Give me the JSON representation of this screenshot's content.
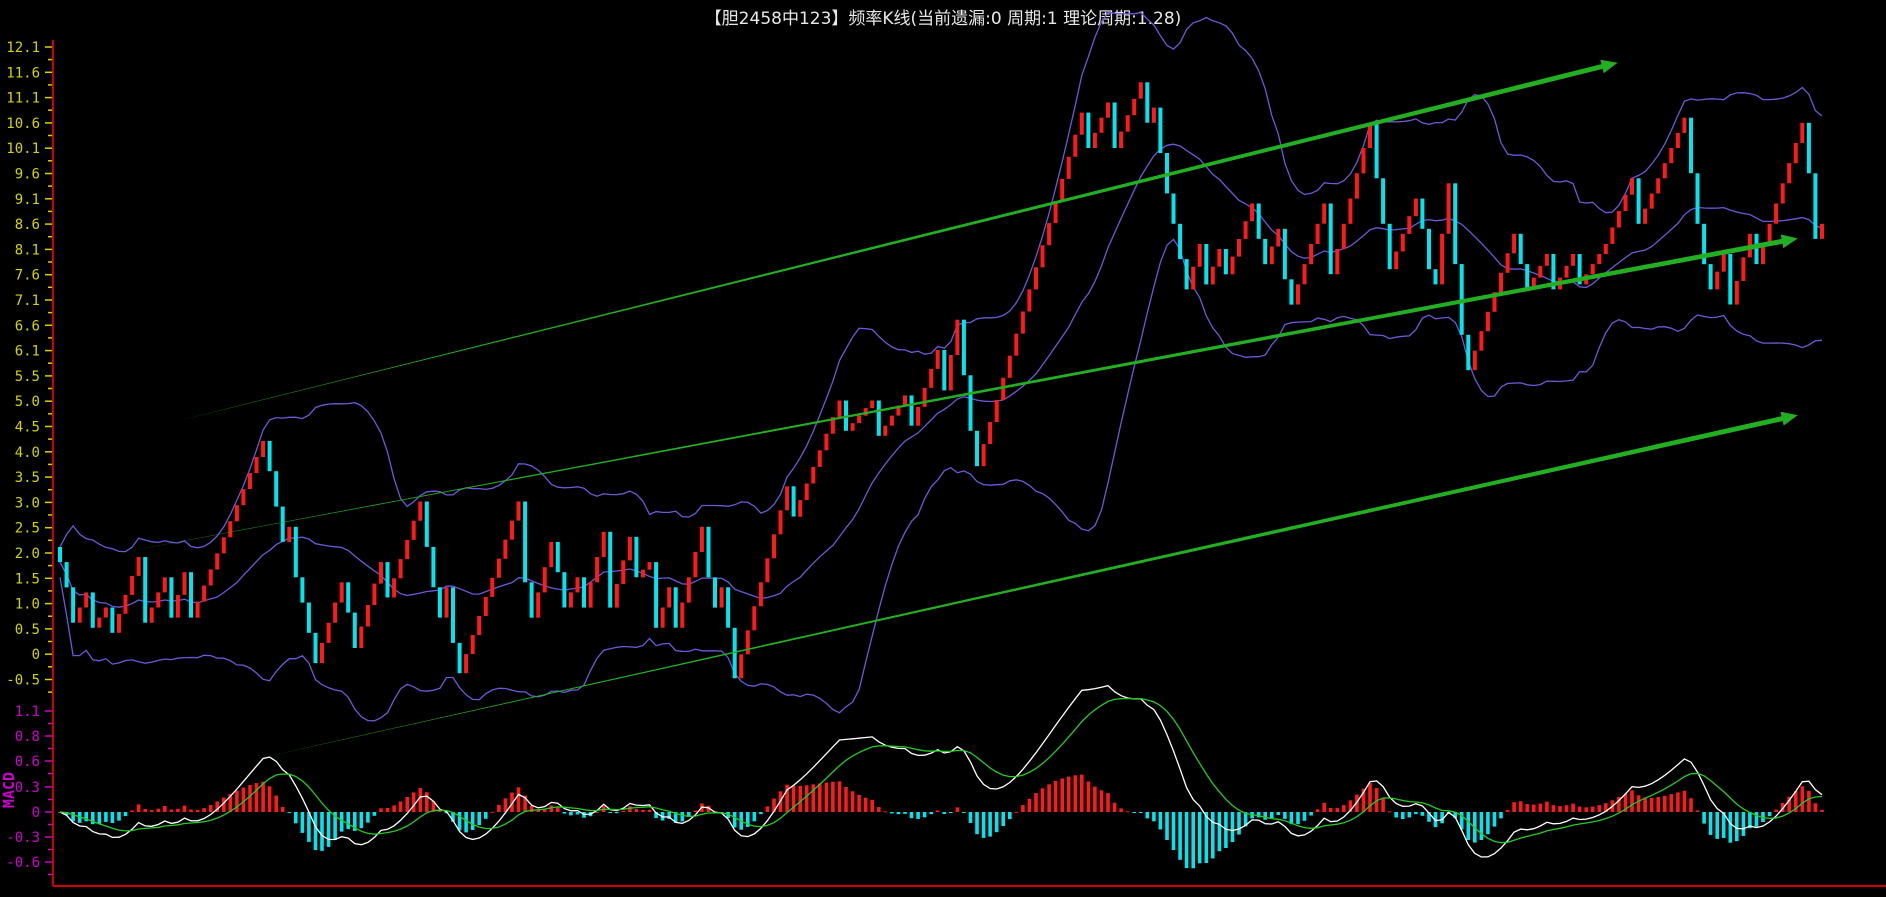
{
  "title": "【胆2458中123】频率K线(当前遗漏:0 周期:1 理论周期:1.28)",
  "colors": {
    "up": "#ff1a1a",
    "down": "#00e5ee",
    "band": "#6a5ad8",
    "axis": "#d00000",
    "price_label": "#d4d400",
    "macd_label": "#d000d0",
    "arrow": "#22b022",
    "dif": "#ffffff",
    "dea": "#22cc22"
  },
  "chart_data": [
    {
      "type": "candlestick",
      "title": "频率K线",
      "ylim": [
        -0.5,
        12.1
      ],
      "yticks": [
        "12.1",
        "11.6",
        "11.1",
        "10.6",
        "10.1",
        "9.6",
        "9.1",
        "8.6",
        "8.1",
        "7.6",
        "7.1",
        "6.6",
        "6.1",
        "5.5",
        "5.0",
        "4.5",
        "4.0",
        "3.5",
        "3.0",
        "2.5",
        "2.0",
        "1.5",
        "1.0",
        "0.5",
        "0",
        "-0.5"
      ],
      "ytick_values": [
        12.1,
        11.6,
        11.1,
        10.6,
        10.1,
        9.6,
        9.1,
        8.6,
        8.1,
        7.6,
        7.1,
        6.6,
        6.1,
        5.6,
        5.1,
        4.6,
        4.1,
        3.6,
        3.1,
        2.6,
        2.1,
        1.6,
        1.1,
        0.6,
        0.1,
        -0.4
      ],
      "overlays": [
        "bollinger upper",
        "bollinger middle",
        "bollinger lower"
      ],
      "close_turning_points": [
        [
          0,
          1.9
        ],
        [
          1,
          1.4
        ],
        [
          2,
          0.7
        ],
        [
          4,
          1.3
        ],
        [
          5,
          0.6
        ],
        [
          7,
          1.0
        ],
        [
          8,
          0.5
        ],
        [
          12,
          2.0
        ],
        [
          13,
          0.7
        ],
        [
          16,
          1.6
        ],
        [
          17,
          0.8
        ],
        [
          19,
          1.7
        ],
        [
          20,
          0.8
        ],
        [
          31,
          4.3
        ],
        [
          32,
          3.7
        ],
        [
          33,
          3.0
        ],
        [
          34,
          2.3
        ],
        [
          35,
          2.6
        ],
        [
          36,
          1.6
        ],
        [
          37,
          1.1
        ],
        [
          38,
          0.5
        ],
        [
          39,
          -0.1
        ],
        [
          43,
          1.5
        ],
        [
          44,
          0.9
        ],
        [
          45,
          0.2
        ],
        [
          49,
          1.9
        ],
        [
          50,
          1.2
        ],
        [
          55,
          3.1
        ],
        [
          56,
          2.2
        ],
        [
          57,
          1.4
        ],
        [
          58,
          0.8
        ],
        [
          59,
          1.4
        ],
        [
          60,
          0.3
        ],
        [
          61,
          -0.3
        ],
        [
          70,
          3.1
        ],
        [
          71,
          1.5
        ],
        [
          72,
          0.8
        ],
        [
          75,
          2.3
        ],
        [
          76,
          1.7
        ],
        [
          77,
          1.0
        ],
        [
          79,
          1.6
        ],
        [
          80,
          1.0
        ],
        [
          83,
          2.5
        ],
        [
          84,
          1.0
        ],
        [
          87,
          2.4
        ],
        [
          88,
          1.6
        ],
        [
          90,
          1.9
        ],
        [
          91,
          0.6
        ],
        [
          93,
          1.4
        ],
        [
          94,
          0.6
        ],
        [
          98,
          2.6
        ],
        [
          99,
          1.6
        ],
        [
          100,
          1.0
        ],
        [
          101,
          1.4
        ],
        [
          102,
          0.6
        ],
        [
          103,
          -0.4
        ],
        [
          111,
          3.4
        ],
        [
          112,
          2.8
        ],
        [
          119,
          5.1
        ],
        [
          120,
          4.5
        ],
        [
          124,
          5.1
        ],
        [
          125,
          4.4
        ],
        [
          129,
          5.2
        ],
        [
          130,
          4.6
        ],
        [
          134,
          6.1
        ],
        [
          135,
          5.3
        ],
        [
          137,
          6.7
        ],
        [
          138,
          5.6
        ],
        [
          139,
          4.5
        ],
        [
          140,
          3.8
        ],
        [
          156,
          10.8
        ],
        [
          157,
          10.1
        ],
        [
          160,
          11.0
        ],
        [
          161,
          10.1
        ],
        [
          165,
          11.4
        ],
        [
          166,
          10.6
        ],
        [
          167,
          10.9
        ],
        [
          168,
          10.0
        ],
        [
          169,
          9.2
        ],
        [
          170,
          8.6
        ],
        [
          171,
          7.9
        ],
        [
          172,
          7.3
        ],
        [
          174,
          8.2
        ],
        [
          175,
          7.4
        ],
        [
          177,
          8.1
        ],
        [
          178,
          7.6
        ],
        [
          182,
          9.0
        ],
        [
          183,
          8.3
        ],
        [
          184,
          7.8
        ],
        [
          186,
          8.5
        ],
        [
          187,
          7.5
        ],
        [
          188,
          7.0
        ],
        [
          193,
          9.0
        ],
        [
          194,
          7.6
        ],
        [
          200,
          10.6
        ],
        [
          201,
          9.5
        ],
        [
          202,
          8.6
        ],
        [
          203,
          7.7
        ],
        [
          207,
          9.1
        ],
        [
          208,
          8.5
        ],
        [
          209,
          7.7
        ],
        [
          210,
          7.4
        ],
        [
          212,
          9.4
        ],
        [
          213,
          7.8
        ],
        [
          214,
          6.4
        ],
        [
          215,
          5.7
        ],
        [
          222,
          8.4
        ],
        [
          223,
          7.8
        ],
        [
          224,
          7.3
        ],
        [
          227,
          8.0
        ],
        [
          228,
          7.3
        ],
        [
          231,
          8.0
        ],
        [
          232,
          7.4
        ],
        [
          236,
          8.2
        ],
        [
          240,
          9.5
        ],
        [
          241,
          8.6
        ],
        [
          248,
          10.7
        ],
        [
          249,
          9.6
        ],
        [
          250,
          8.6
        ],
        [
          251,
          7.8
        ],
        [
          252,
          7.3
        ],
        [
          254,
          8.0
        ],
        [
          255,
          7.0
        ],
        [
          258,
          8.4
        ],
        [
          259,
          7.8
        ],
        [
          266,
          10.6
        ],
        [
          267,
          9.6
        ],
        [
          268,
          8.3
        ],
        [
          269,
          8.6
        ]
      ],
      "trend_arrows": [
        {
          "from": [
            17.8,
            4.69
          ],
          "to": [
            237.8,
            11.79
          ]
        },
        {
          "from": [
            8.6,
            2.07
          ],
          "to": [
            265.3,
            8.31
          ]
        },
        {
          "from": [
            30.6,
            -1.98
          ],
          "to": [
            265.3,
            4.81
          ]
        }
      ]
    },
    {
      "type": "bar+line",
      "title": "MACD",
      "ylabel": "MACD",
      "yticks": [
        "1.1",
        "0.8",
        "0.6",
        "0.3",
        "0",
        "-0.3",
        "-0.6"
      ],
      "series": [
        {
          "name": "DIF"
        },
        {
          "name": "DEA"
        },
        {
          "name": "MACD histogram"
        }
      ]
    }
  ]
}
